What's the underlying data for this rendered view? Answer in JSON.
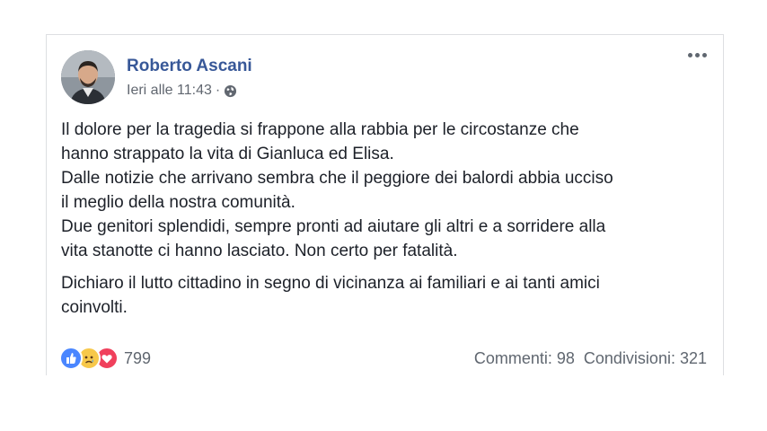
{
  "post": {
    "author": "Roberto Ascani",
    "timestamp": "Ieri alle 11:43",
    "separator": "·",
    "privacy_icon": "globe-icon",
    "menu_icon": "more-icon",
    "paragraphs": [
      [
        "Il dolore per la tragedia si frappone alla rabbia per le circostanze che",
        "hanno strappato la vita di Gianluca ed Elisa.",
        "Dalle notizie che arrivano sembra che il peggiore dei balordi abbia ucciso",
        "il meglio della nostra comunità.",
        "Due genitori splendidi, sempre pronti ad aiutare gli altri e a sorridere alla",
        "vita stanotte ci hanno lasciato. Non certo per fatalità."
      ],
      [
        "Dichiaro il lutto cittadino in segno di vicinanza ai familiari e ai tanti amici",
        "coinvolti."
      ]
    ]
  },
  "reactions": {
    "icons": [
      "like-icon",
      "sad-icon",
      "love-icon"
    ],
    "count": "799"
  },
  "stats": {
    "comments": "Commenti: 98",
    "shares": "Condivisioni: 321"
  },
  "colors": {
    "author": "#385898",
    "text": "#1d2129",
    "secondary": "#616770",
    "like": "#4a86ff",
    "sad": "#f7c84a",
    "love": "#f0405c"
  }
}
